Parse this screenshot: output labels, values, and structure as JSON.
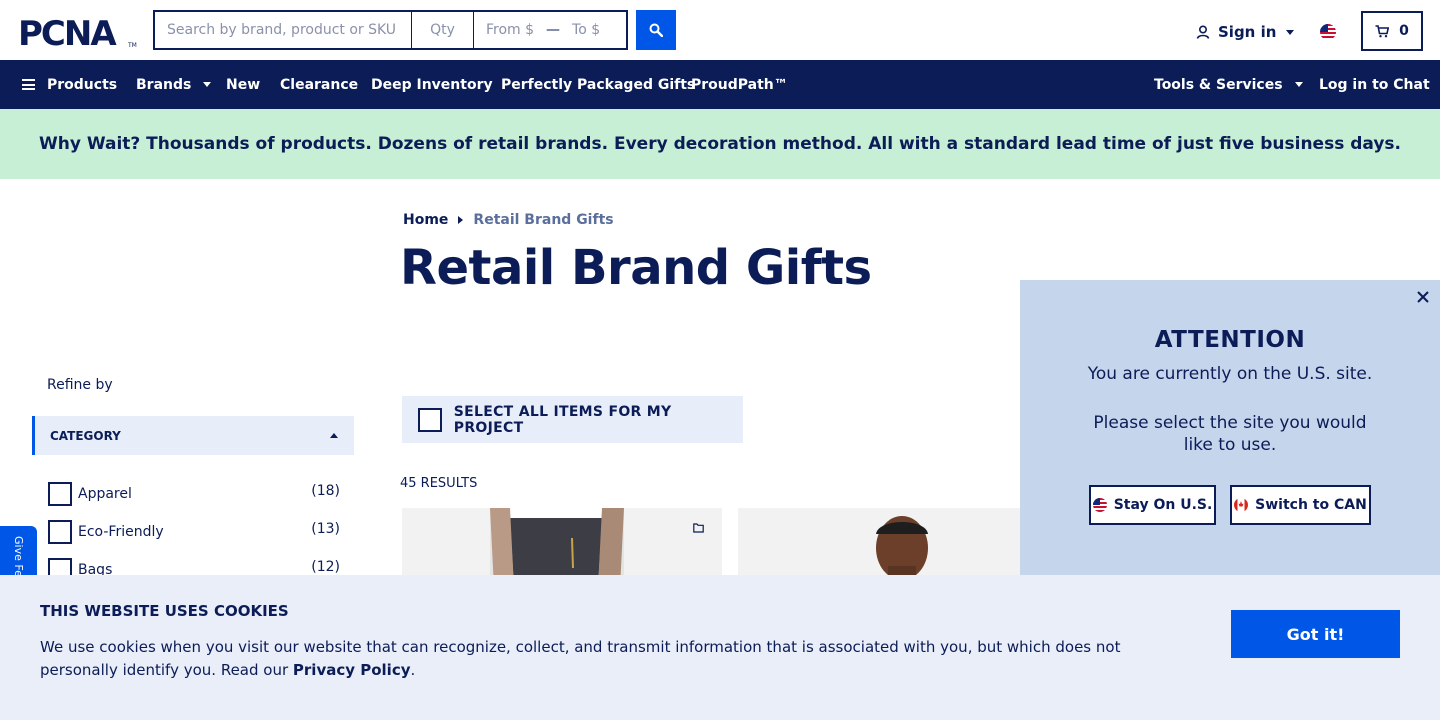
{
  "header": {
    "logo_text": "PCNA",
    "search_placeholder": "Search by brand, product or SKU",
    "qty_placeholder": "Qty",
    "price_from": "From $",
    "price_to": "To $",
    "signin_label": "Sign in",
    "cart_count": "0"
  },
  "nav": {
    "products": "Products",
    "brands": "Brands",
    "new": "New",
    "clearance": "Clearance",
    "deep_inventory": "Deep Inventory",
    "perfectly_packaged": "Perfectly Packaged Gifts",
    "proudpath": "ProudPath™",
    "tools_services": "Tools & Services",
    "chat": "Log in to Chat"
  },
  "banner": {
    "text": "Why Wait? Thousands of products. Dozens of retail brands. Every decoration method. All with a standard lead time of just five business days."
  },
  "breadcrumb": {
    "home": "Home",
    "current": "Retail Brand Gifts"
  },
  "page_title": "Retail Brand Gifts",
  "sidebar": {
    "refine_label": "Refine by",
    "category_header": "CATEGORY",
    "categories": [
      {
        "label": "Apparel",
        "count": "(18)"
      },
      {
        "label": "Eco-Friendly",
        "count": "(13)"
      },
      {
        "label": "Bags",
        "count": "(12)"
      }
    ],
    "feedback_label": "Give Feedback"
  },
  "main": {
    "select_all_label": "SELECT ALL ITEMS FOR MY PROJECT",
    "results_count": "45 RESULTS"
  },
  "modal": {
    "title": "ATTENTION",
    "message": "You are currently on the U.S. site.",
    "message2": "Please select the site you would like to use.",
    "stay_label": "Stay On U.S.",
    "switch_label": "Switch to CAN"
  },
  "cookie": {
    "title": "THIS WEBSITE USES COOKIES",
    "text": "We use cookies when you visit our website that can recognize, collect, and transmit information that is associated with you, but which does not personally identify you. Read our ",
    "link": "Privacy Policy",
    "end": ".",
    "button": "Got it!"
  },
  "colors": {
    "navy": "#0b1c57",
    "blue": "#0057e7",
    "banner_green": "#c6efd5",
    "light_blue": "#e8eef9",
    "modal_bg": "#c5d5ec"
  }
}
